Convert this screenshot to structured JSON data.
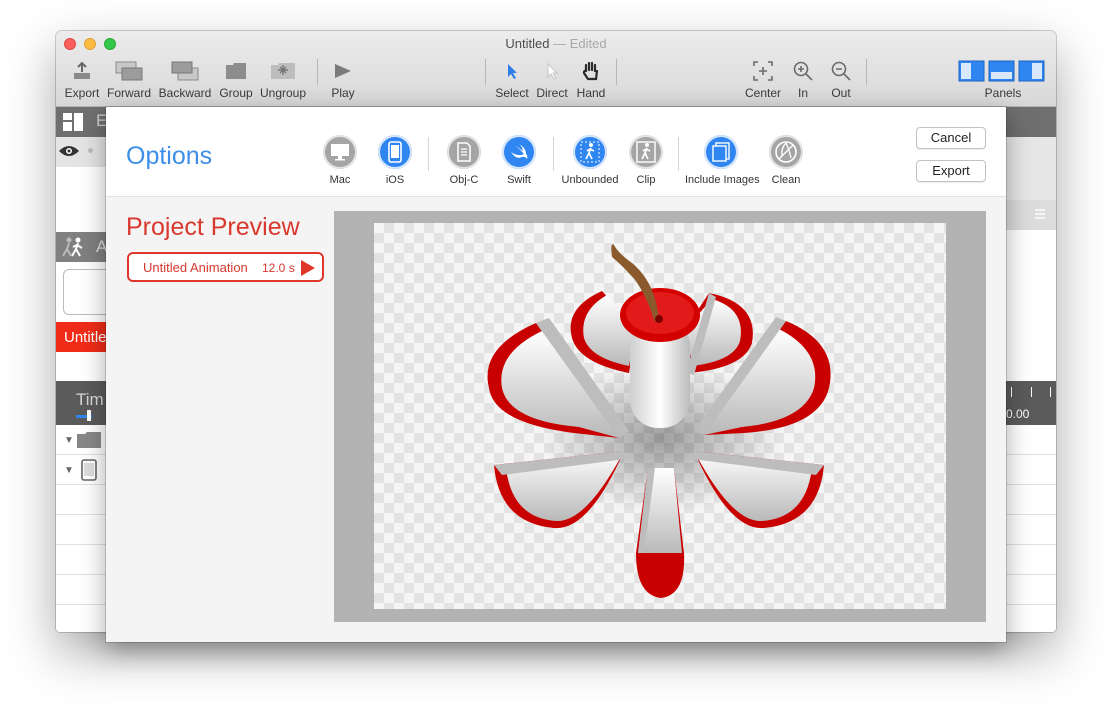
{
  "window": {
    "title": "Untitled",
    "title_sep": "—",
    "title_status": "Edited"
  },
  "toolbar": {
    "export": "Export",
    "forward": "Forward",
    "backward": "Backward",
    "group": "Group",
    "ungroup": "Ungroup",
    "play": "Play",
    "select": "Select",
    "direct": "Direct",
    "hand": "Hand",
    "center": "Center",
    "zoom_in": "In",
    "zoom_out": "Out",
    "panels": "Panels"
  },
  "background": {
    "partial_letter": "E",
    "partial_anim": "A",
    "partial_row": "Untitle",
    "timeline_partial": "Tim",
    "time_readout": "0.00"
  },
  "dialog": {
    "options_title": "Options",
    "options": [
      {
        "label": "Mac",
        "state": "off",
        "icon": "mac-icon"
      },
      {
        "label": "iOS",
        "state": "on",
        "icon": "ios-device-icon"
      },
      {
        "label": "Obj-C",
        "state": "off",
        "icon": "objc-file-icon"
      },
      {
        "label": "Swift",
        "state": "on",
        "icon": "swift-icon"
      },
      {
        "label": "Unbounded",
        "state": "on",
        "icon": "unbounded-icon"
      },
      {
        "label": "Clip",
        "state": "off",
        "icon": "clip-icon"
      },
      {
        "label": "Include Images",
        "state": "on",
        "icon": "images-icon"
      },
      {
        "label": "Clean",
        "state": "off",
        "icon": "clean-icon"
      }
    ],
    "cancel": "Cancel",
    "export": "Export",
    "project_preview_title": "Project Preview",
    "animation": {
      "name": "Untitled Animation",
      "duration": "12.0 s"
    }
  },
  "colors": {
    "accent_blue": "#2f86f0",
    "accent_red": "#d8382e",
    "inactive_gray": "#a5a5a5"
  }
}
